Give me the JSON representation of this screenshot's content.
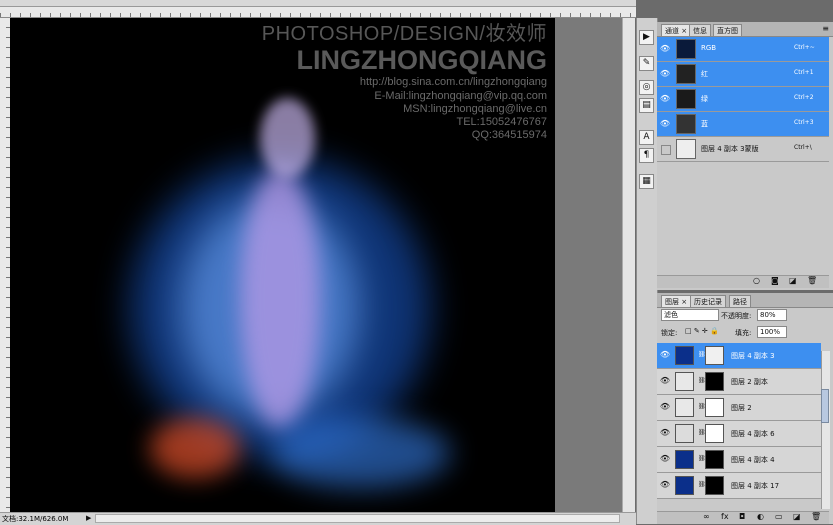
{
  "watermark": {
    "line1": "PHOTOSHOP/DESIGN/妆效师",
    "line2": "LINGZHONGQIANG",
    "line3": "http://blog.sina.com.cn/lingzhongqiang",
    "line4": "E-Mail:lingzhongqiang@vip.qq.com",
    "line5": "MSN:lingzhongqiang@live.cn",
    "line6": "TEL:15052476767",
    "line7": "QQ:364515974"
  },
  "status": {
    "text": "文档:32.1M/626.0M",
    "arrow": "▶"
  },
  "mini_tools": [
    "play-icon",
    "brush-settings-icon",
    "clone-source-icon",
    "tool-presets-icon",
    "character-icon",
    "paragraph-icon",
    "layer-comps-icon"
  ],
  "channels_panel": {
    "tabs": [
      "通道 ×",
      "信息",
      "直方图"
    ],
    "menu_icon": "≡",
    "rows": [
      {
        "name": "RGB",
        "shortcut": "Ctrl+~",
        "selected": true
      },
      {
        "name": "红",
        "shortcut": "Ctrl+1",
        "selected": true
      },
      {
        "name": "绿",
        "shortcut": "Ctrl+2",
        "selected": true
      },
      {
        "name": "蓝",
        "shortcut": "Ctrl+3",
        "selected": true
      },
      {
        "name": "图层 4 副本 3蒙版",
        "shortcut": "Ctrl+\\",
        "selected": false
      }
    ],
    "footer_icons": [
      "○",
      "◙",
      "◪",
      "🗑"
    ]
  },
  "layers_panel": {
    "tabs": [
      "图层 ×",
      "历史记录",
      "路径"
    ],
    "blend_mode": "滤色",
    "opacity_label": "不透明度:",
    "opacity_value": "80%",
    "lock_label": "锁定:",
    "fill_label": "填充:",
    "fill_value": "100%",
    "layers": [
      {
        "name": "图层 4 副本 3",
        "selected": true
      },
      {
        "name": "图层 2 副本",
        "selected": false
      },
      {
        "name": "图层 2",
        "selected": false
      },
      {
        "name": "图层 4 副本 6",
        "selected": false
      },
      {
        "name": "图层 4 副本 4",
        "selected": false
      },
      {
        "name": "图层 4 副本 17",
        "selected": false
      }
    ],
    "footer_icons": [
      "∞",
      "fx",
      "◘",
      "◐",
      "▭",
      "◪",
      "🗑"
    ]
  },
  "colors": {
    "selection": "#3d8ff0",
    "panel": "#c9c9c9",
    "canvas_bg": "#000000"
  }
}
